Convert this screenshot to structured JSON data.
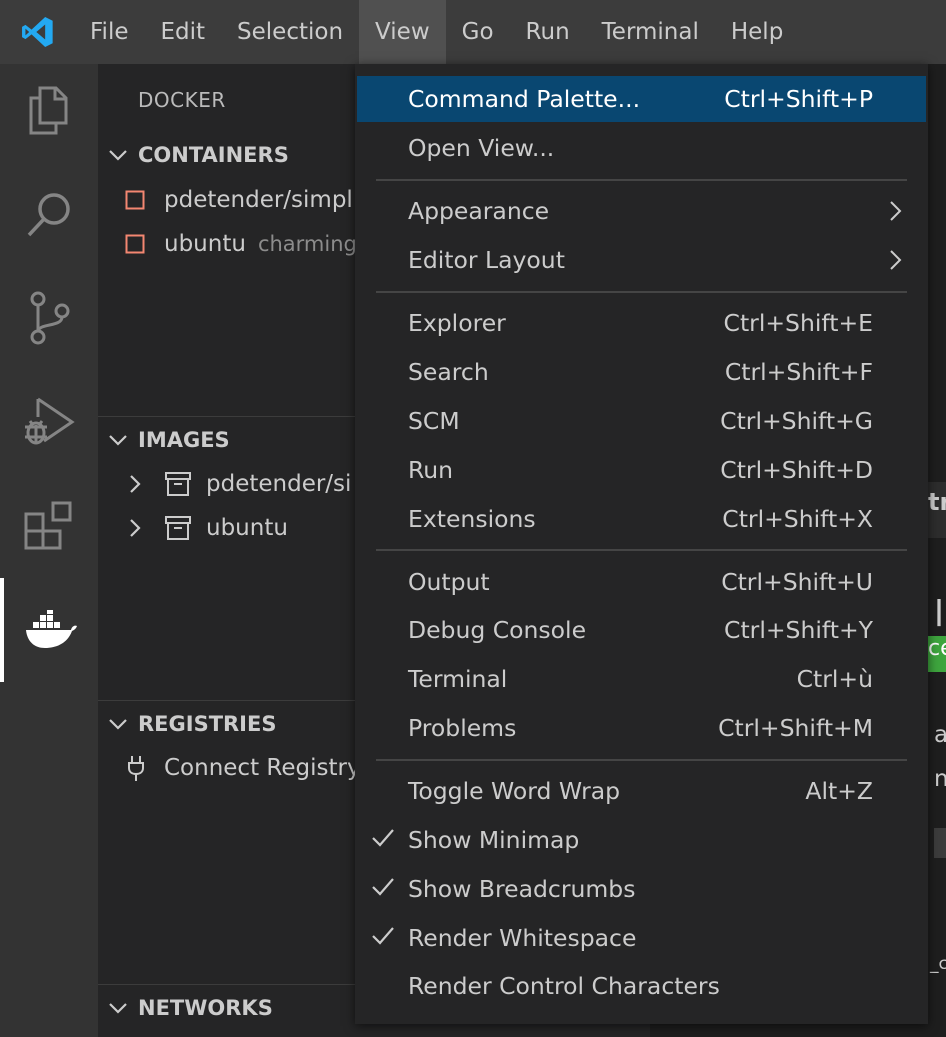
{
  "menubar": {
    "items": [
      "File",
      "Edit",
      "Selection",
      "View",
      "Go",
      "Run",
      "Terminal",
      "Help"
    ]
  },
  "activitybar": {
    "icons": [
      "files-icon",
      "search-icon",
      "source-control-icon",
      "run-debug-icon",
      "extensions-icon",
      "docker-icon"
    ]
  },
  "sidebar": {
    "title": "DOCKER",
    "containers": {
      "header": "CONTAINERS",
      "items": [
        {
          "label": "pdetender/simpl",
          "sub": ""
        },
        {
          "label": "ubuntu",
          "sub": "charming"
        }
      ]
    },
    "images": {
      "header": "IMAGES",
      "items": [
        "pdetender/si",
        "ubuntu"
      ]
    },
    "registries": {
      "header": "REGISTRIES",
      "connect_label": "Connect Registry"
    },
    "networks": {
      "header": "NETWORKS"
    }
  },
  "view_menu": {
    "groups": [
      [
        {
          "label": "Command Palette...",
          "shortcut": "Ctrl+Shift+P"
        },
        {
          "label": "Open View...",
          "shortcut": ""
        }
      ],
      [
        {
          "label": "Appearance",
          "shortcut": ""
        },
        {
          "label": "Editor Layout",
          "shortcut": ""
        }
      ],
      [
        {
          "label": "Explorer",
          "shortcut": "Ctrl+Shift+E"
        },
        {
          "label": "Search",
          "shortcut": "Ctrl+Shift+F"
        },
        {
          "label": "SCM",
          "shortcut": "Ctrl+Shift+G"
        },
        {
          "label": "Run",
          "shortcut": "Ctrl+Shift+D"
        },
        {
          "label": "Extensions",
          "shortcut": "Ctrl+Shift+X"
        }
      ],
      [
        {
          "label": "Output",
          "shortcut": "Ctrl+Shift+U"
        },
        {
          "label": "Debug Console",
          "shortcut": "Ctrl+Shift+Y"
        },
        {
          "label": "Terminal",
          "shortcut": "Ctrl+ù"
        },
        {
          "label": "Problems",
          "shortcut": "Ctrl+Shift+M"
        }
      ],
      [
        {
          "label": "Toggle Word Wrap",
          "shortcut": "Alt+Z"
        },
        {
          "label": "Show Minimap",
          "shortcut": ""
        },
        {
          "label": "Show Breadcrumbs",
          "shortcut": ""
        },
        {
          "label": "Render Whitespace",
          "shortcut": ""
        },
        {
          "label": "Render Control Characters",
          "shortcut": ""
        }
      ]
    ]
  },
  "editor_peek": {
    "fragments": [
      "tr",
      "l",
      "ce",
      "ak",
      "ne",
      "_ca"
    ]
  },
  "colors": {
    "menubar_bg": "#3c3c3c",
    "activitybar_bg": "#333333",
    "sidebar_bg": "#252526",
    "menu_selection": "#094771",
    "container_icon": "#f48771",
    "vscode_blue": "#23a9f2",
    "green_badge": "#3ea53e"
  }
}
